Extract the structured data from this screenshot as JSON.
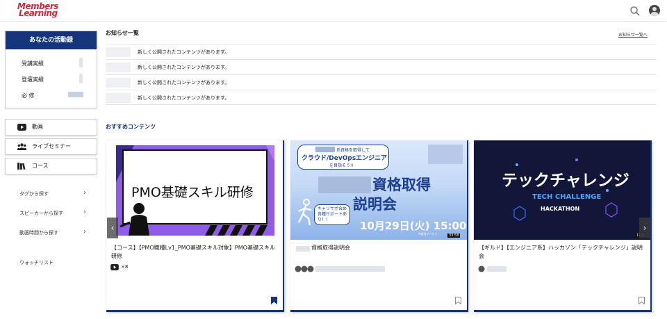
{
  "header": {
    "logo_line1": "Members",
    "logo_line2": "Learning",
    "search_icon": "search-icon",
    "avatar_icon": "user-avatar-icon"
  },
  "activity": {
    "title": "あなたの活動録",
    "rows": [
      {
        "label": "受講実績"
      },
      {
        "label": "登壇実績"
      },
      {
        "label": "必 修"
      }
    ]
  },
  "nav": {
    "items": [
      {
        "label": "動画",
        "icon": "youtube-icon"
      },
      {
        "label": "ライブセミナー",
        "icon": "people-icon"
      },
      {
        "label": "コース",
        "icon": "books-icon"
      }
    ],
    "links": [
      {
        "label": "タグから探す"
      },
      {
        "label": "スピーカーから探す"
      },
      {
        "label": "動画時間から探す"
      }
    ],
    "watchlist": "ウォッチリスト"
  },
  "news": {
    "title": "お知らせ一覧",
    "more": "お知らせ一覧へ",
    "items": [
      {
        "text": "新しく公開されたコンテンツがあります。"
      },
      {
        "text": "新しく公開されたコンテンツがあります。"
      },
      {
        "text": "新しく公開されたコンテンツがあります。"
      },
      {
        "text": "新しく公開されたコンテンツがあります。"
      }
    ]
  },
  "recommended": {
    "title": "おすすめコンテンツ",
    "cards": [
      {
        "thumb_text": "PMO基礎スキル研修",
        "title": "【コース】【PMO職種Lv1_PMO基礎スキル対象】PMO基礎スキル研修",
        "count": "×8",
        "bookmarked": true
      },
      {
        "thumb_line1": "系資格を取得して",
        "thumb_line2": "クラウド/DevOpsエンジニア",
        "thumb_line3": "を目指そう!!",
        "thumb_big1": "資格取得",
        "thumb_big2": "説明会",
        "thumb_bubble": "キャリサポ含め各種サポートあり！！",
        "thumb_date": "10月29日(火) 15:00〜",
        "thumb_archive": "※後日アーカイ",
        "duration": "33:58",
        "title": "資格取得説明会",
        "bookmarked": false
      },
      {
        "thumb_big": "テックチャレンジ",
        "thumb_sub1": "TECH CHALLENGE",
        "thumb_sub2": "HACKATHON",
        "duration": "11:1",
        "title": "【ギルド】【エンジニア系】ハッカソン「テックチャレンジ」説明会",
        "bookmarked": false
      }
    ]
  },
  "colors": {
    "accent": "#15357a",
    "brand": "#d6263a"
  }
}
